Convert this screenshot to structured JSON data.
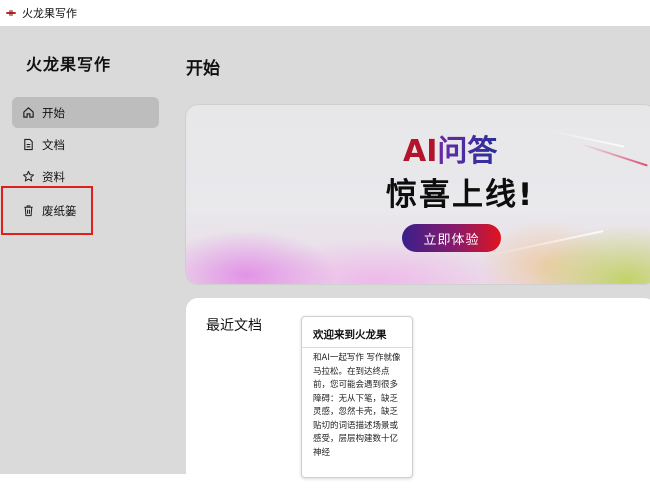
{
  "window": {
    "title": "火龙果写作"
  },
  "sidebar": {
    "brand": "火龙果写作",
    "items": [
      {
        "label": "开始",
        "icon": "home-icon",
        "active": true
      },
      {
        "label": "文档",
        "icon": "document-icon",
        "active": false
      },
      {
        "label": "资料",
        "icon": "star-icon",
        "active": false
      },
      {
        "label": "废纸篓",
        "icon": "trash-icon",
        "active": false
      }
    ]
  },
  "main": {
    "title": "开始",
    "banner": {
      "title_ai": "AI",
      "title_rest": "问答",
      "subtitle": "惊喜上线!",
      "cta": "立即体验"
    },
    "recent": {
      "title": "最近文档",
      "cards": [
        {
          "title": "欢迎来到火龙果",
          "body": "和AI一起写作 写作就像马拉松。在到达终点前，您可能会遇到很多障碍：无从下笔，缺乏灵感，忽然卡壳，缺乏贴切的词语描述场景或感受，层层构建数十亿神经"
        }
      ]
    }
  },
  "colors": {
    "accent_red": "#e0201b",
    "surface": "#dadada",
    "cta_gradient_start": "#3a1f8c",
    "cta_gradient_end": "#e0141e"
  }
}
